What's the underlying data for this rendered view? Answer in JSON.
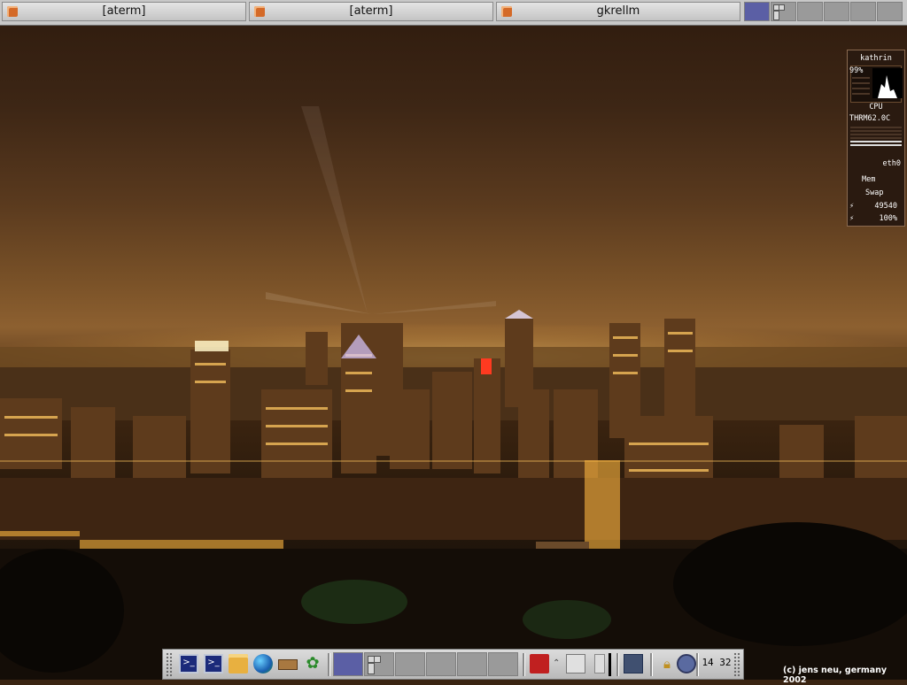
{
  "taskbar": {
    "tasks": [
      {
        "title": "[aterm]",
        "icon": "app-icon"
      },
      {
        "title": "[aterm]",
        "icon": "app-icon"
      },
      {
        "title": "gkrellm",
        "icon": "app-icon"
      }
    ],
    "desktops": {
      "count": 6,
      "active": 1
    }
  },
  "gkrellm": {
    "hostname": "kathrin",
    "cpu_load": "99%",
    "cpu_label": "CPU",
    "thermal": "THRM62.0C",
    "net_label": "eth0",
    "mem_label": "Mem",
    "swap_label": "Swap",
    "mail_count": "49540",
    "battery": "100%"
  },
  "dock": {
    "launchers": [
      "terminal-icon",
      "terminal-icon",
      "folder-icon",
      "globe-icon",
      "package-icon",
      "gear-flower-icon"
    ],
    "applets": [
      "toolbox-icon",
      "volume-icon",
      "network-icon",
      "lock-icon",
      "clock-app-icon"
    ],
    "clock": "14 32",
    "desktops": {
      "count": 6,
      "active": 1
    }
  },
  "wallpaper": {
    "credit": "(c) jens neu, germany 2002",
    "colors": {
      "sky": "#5a3a1e",
      "lights": "#ffcc66"
    }
  }
}
